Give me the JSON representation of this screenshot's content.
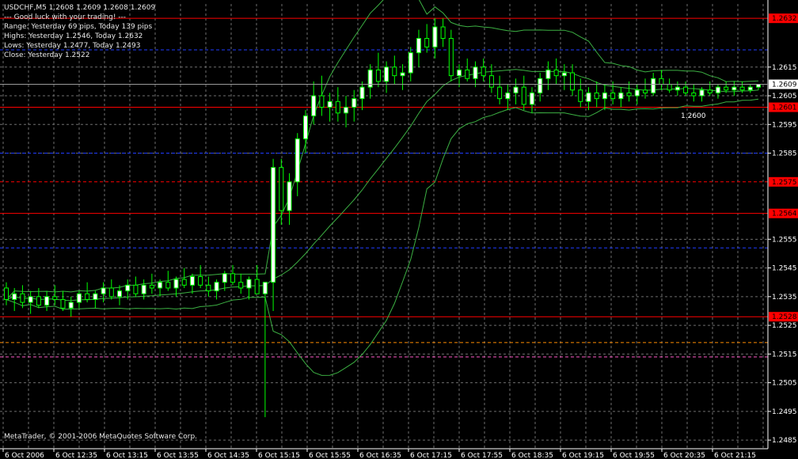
{
  "window": {
    "header": "USDCHF,M5  1.2608 1.2609 1.2608 1.2609",
    "greeting": "--- Good luck with your trading! ---",
    "range": "Range: Yesterday 69 pips, Today 139 pips",
    "highs": "Highs: Yesterday 1.2546, Today 1.2632",
    "lows": "Lows: Yesterday 1.2477, Today 1.2493",
    "close": "Close: Yesterday 1.2522",
    "copyright": "MetaTrader, © 2001-2006 MetaQuotes Software Corp."
  },
  "colors": {
    "background": "#000000",
    "axis": "#ffffff",
    "grid": "#6e6e6e",
    "bollinger": "#3cb043",
    "bull_candle": "#ffffff",
    "bear_candle": "#000000",
    "candle_wick": "#00ff00",
    "red_level": "#ff0000",
    "blue_level": "#1f3cff",
    "orange_level": "#ff8c00",
    "pink_level": "#ff59c8",
    "price_marker": "#ffffff"
  },
  "price_axis": {
    "ticks": [
      "1.2615",
      "1.2605",
      "1.2595",
      "1.2585",
      "1.2555",
      "1.2545",
      "1.2535",
      "1.2525",
      "1.2515",
      "1.2505",
      "1.2495",
      "1.2485"
    ],
    "current_price": "1.2609"
  },
  "time_axis": {
    "labels": [
      "6 Oct 2006",
      "6 Oct 12:35",
      "6 Oct 13:15",
      "6 Oct 13:55",
      "6 Oct 14:35",
      "6 Oct 15:15",
      "6 Oct 15:55",
      "6 Oct 16:35",
      "6 Oct 17:15",
      "6 Oct 17:55",
      "6 Oct 18:35",
      "6 Oct 19:15",
      "6 Oct 19:55",
      "6 Oct 20:35",
      "6 Oct 21:15"
    ]
  },
  "levels": [
    {
      "price": "1.2632",
      "color": "red",
      "style": "solid",
      "label": "1.2632"
    },
    {
      "price": "1.2621",
      "color": "blue",
      "style": "dashed",
      "label": ""
    },
    {
      "price": "1.2601",
      "color": "red",
      "style": "solid",
      "label": "1.2601"
    },
    {
      "price": "1.2585",
      "color": "blue",
      "style": "dashed",
      "label": ""
    },
    {
      "price": "1.2575",
      "color": "red",
      "style": "dashed",
      "label": "1.2575"
    },
    {
      "price": "1.2564",
      "color": "red",
      "style": "solid",
      "label": "1.2564"
    },
    {
      "price": "1.2552",
      "color": "blue",
      "style": "dashed",
      "label": ""
    },
    {
      "price": "1.2528",
      "color": "red",
      "style": "solid",
      "label": "1.2528"
    },
    {
      "price": "1.2519",
      "color": "orange",
      "style": "dashed",
      "label": ""
    },
    {
      "price": "1.2514",
      "color": "pink",
      "style": "dashed",
      "label": ""
    }
  ],
  "annotation": {
    "price": "1.2600",
    "label": "1.2600"
  },
  "chart_data": {
    "type": "candlestick",
    "symbol": "USDCHF",
    "timeframe": "M5",
    "ylim": [
      1.2482,
      1.2637
    ],
    "candles": [
      [
        1.2538,
        1.254,
        1.2532,
        1.2534
      ],
      [
        1.2534,
        1.2538,
        1.253,
        1.2536
      ],
      [
        1.2536,
        1.2539,
        1.2531,
        1.2533
      ],
      [
        1.2533,
        1.2537,
        1.2529,
        1.2535
      ],
      [
        1.2535,
        1.2538,
        1.2531,
        1.2532
      ],
      [
        1.2532,
        1.2537,
        1.253,
        1.2535
      ],
      [
        1.2535,
        1.2539,
        1.2532,
        1.2534
      ],
      [
        1.2534,
        1.2537,
        1.253,
        1.2531
      ],
      [
        1.2531,
        1.2535,
        1.2528,
        1.2533
      ],
      [
        1.2533,
        1.2537,
        1.2531,
        1.2536
      ],
      [
        1.2536,
        1.254,
        1.2533,
        1.2534
      ],
      [
        1.2534,
        1.2537,
        1.2531,
        1.2536
      ],
      [
        1.2536,
        1.254,
        1.2533,
        1.2538
      ],
      [
        1.2538,
        1.2541,
        1.2534,
        1.2535
      ],
      [
        1.2535,
        1.2539,
        1.2532,
        1.2537
      ],
      [
        1.2537,
        1.2541,
        1.2534,
        1.2539
      ],
      [
        1.2539,
        1.2542,
        1.2535,
        1.2536
      ],
      [
        1.2536,
        1.2541,
        1.2534,
        1.2539
      ],
      [
        1.2539,
        1.2543,
        1.2536,
        1.2538
      ],
      [
        1.2538,
        1.2541,
        1.2535,
        1.254
      ],
      [
        1.254,
        1.2544,
        1.2537,
        1.2538
      ],
      [
        1.2538,
        1.2542,
        1.2535,
        1.2541
      ],
      [
        1.2541,
        1.2545,
        1.2538,
        1.2539
      ],
      [
        1.2539,
        1.2543,
        1.2536,
        1.2542
      ],
      [
        1.2542,
        1.2546,
        1.2538,
        1.2539
      ],
      [
        1.2539,
        1.2542,
        1.2535,
        1.2537
      ],
      [
        1.2537,
        1.2541,
        1.2534,
        1.254
      ],
      [
        1.254,
        1.2544,
        1.2537,
        1.2543
      ],
      [
        1.2543,
        1.2546,
        1.2539,
        1.254
      ],
      [
        1.254,
        1.2543,
        1.2536,
        1.2538
      ],
      [
        1.2538,
        1.2542,
        1.2534,
        1.2541
      ],
      [
        1.2541,
        1.2546,
        1.2538,
        1.2536
      ],
      [
        1.2536,
        1.254,
        1.2493,
        1.254
      ],
      [
        1.254,
        1.2583,
        1.253,
        1.258
      ],
      [
        1.258,
        1.2583,
        1.256,
        1.2565
      ],
      [
        1.2565,
        1.2578,
        1.256,
        1.2575
      ],
      [
        1.2575,
        1.2592,
        1.257,
        1.259
      ],
      [
        1.259,
        1.26,
        1.2585,
        1.2598
      ],
      [
        1.2598,
        1.261,
        1.2595,
        1.2605
      ],
      [
        1.2605,
        1.2612,
        1.2598,
        1.2601
      ],
      [
        1.2601,
        1.2606,
        1.2596,
        1.2603
      ],
      [
        1.2603,
        1.2608,
        1.2596,
        1.2599
      ],
      [
        1.2599,
        1.2605,
        1.2594,
        1.2601
      ],
      [
        1.2601,
        1.2607,
        1.2596,
        1.2604
      ],
      [
        1.2604,
        1.261,
        1.26,
        1.2608
      ],
      [
        1.2608,
        1.2616,
        1.2604,
        1.2614
      ],
      [
        1.2614,
        1.262,
        1.2608,
        1.261
      ],
      [
        1.261,
        1.2617,
        1.2606,
        1.2615
      ],
      [
        1.2615,
        1.2619,
        1.2609,
        1.2612
      ],
      [
        1.2612,
        1.2616,
        1.2607,
        1.2613
      ],
      [
        1.2613,
        1.2622,
        1.261,
        1.262
      ],
      [
        1.262,
        1.2628,
        1.2615,
        1.2625
      ],
      [
        1.2625,
        1.263,
        1.262,
        1.2622
      ],
      [
        1.2622,
        1.2632,
        1.2618,
        1.2629
      ],
      [
        1.2629,
        1.2632,
        1.2622,
        1.2625
      ],
      [
        1.2625,
        1.2628,
        1.261,
        1.2612
      ],
      [
        1.2612,
        1.2616,
        1.2608,
        1.2614
      ],
      [
        1.2614,
        1.2618,
        1.261,
        1.2611
      ],
      [
        1.2611,
        1.2617,
        1.2608,
        1.2615
      ],
      [
        1.2615,
        1.2618,
        1.261,
        1.2612
      ],
      [
        1.2612,
        1.2616,
        1.2606,
        1.2608
      ],
      [
        1.2608,
        1.2612,
        1.2602,
        1.2604
      ],
      [
        1.2604,
        1.2609,
        1.26,
        1.2606
      ],
      [
        1.2606,
        1.2611,
        1.2602,
        1.2608
      ],
      [
        1.2608,
        1.2612,
        1.26,
        1.2602
      ],
      [
        1.2602,
        1.2608,
        1.2599,
        1.2606
      ],
      [
        1.2606,
        1.2613,
        1.2603,
        1.2611
      ],
      [
        1.2611,
        1.2617,
        1.2607,
        1.2614
      ],
      [
        1.2614,
        1.2618,
        1.2609,
        1.2612
      ],
      [
        1.2612,
        1.2616,
        1.2607,
        1.2613
      ],
      [
        1.2613,
        1.2616,
        1.2605,
        1.2607
      ],
      [
        1.2607,
        1.2611,
        1.2601,
        1.2603
      ],
      [
        1.2603,
        1.2608,
        1.26,
        1.2606
      ],
      [
        1.2606,
        1.261,
        1.2601,
        1.2604
      ],
      [
        1.2604,
        1.2609,
        1.26,
        1.2606
      ],
      [
        1.2606,
        1.261,
        1.2602,
        1.2604
      ],
      [
        1.2604,
        1.2608,
        1.2601,
        1.2606
      ],
      [
        1.2606,
        1.261,
        1.2603,
        1.2605
      ],
      [
        1.2605,
        1.2609,
        1.2602,
        1.2607
      ],
      [
        1.2607,
        1.2611,
        1.2604,
        1.2606
      ],
      [
        1.2606,
        1.2613,
        1.2605,
        1.2611
      ],
      [
        1.2611,
        1.2614,
        1.2607,
        1.2609
      ],
      [
        1.2609,
        1.2611,
        1.2606,
        1.2607
      ],
      [
        1.2607,
        1.261,
        1.2605,
        1.2608
      ],
      [
        1.2608,
        1.261,
        1.2605,
        1.2606
      ],
      [
        1.2606,
        1.2609,
        1.2603,
        1.2605
      ],
      [
        1.2605,
        1.2608,
        1.2603,
        1.2607
      ],
      [
        1.2607,
        1.261,
        1.2605,
        1.2606
      ],
      [
        1.2606,
        1.2609,
        1.2604,
        1.2608
      ],
      [
        1.2608,
        1.261,
        1.2606,
        1.2607
      ],
      [
        1.2607,
        1.261,
        1.2605,
        1.2608
      ],
      [
        1.2608,
        1.261,
        1.2606,
        1.2607
      ],
      [
        1.2607,
        1.2609,
        1.2606,
        1.2608
      ],
      [
        1.2608,
        1.2609,
        1.2607,
        1.2609
      ]
    ]
  }
}
